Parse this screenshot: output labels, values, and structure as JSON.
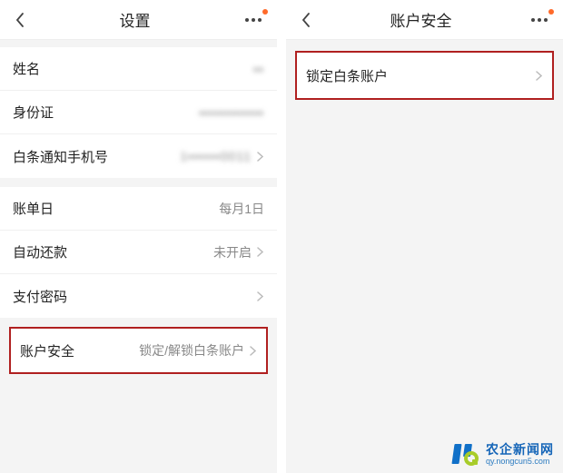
{
  "left": {
    "header": {
      "title": "设置"
    },
    "group1": {
      "name": {
        "label": "姓名",
        "value": "▪▪"
      },
      "idcard": {
        "label": "身份证",
        "value": "▪▪▪▪▪▪▪▪▪▪▪▪"
      },
      "phone": {
        "label": "白条通知手机号",
        "value": "1▪▪▪▪▪▪0011"
      }
    },
    "group2": {
      "billday": {
        "label": "账单日",
        "value": "每月1日"
      },
      "autorepay": {
        "label": "自动还款",
        "value": "未开启"
      },
      "paypwd": {
        "label": "支付密码",
        "value": ""
      }
    },
    "security": {
      "label": "账户安全",
      "value": "锁定/解锁白条账户"
    }
  },
  "right": {
    "header": {
      "title": "账户安全"
    },
    "item": {
      "label": "锁定白条账户"
    }
  },
  "brand": {
    "cn": "农企新闻网",
    "url": "qy.nongcun5.com"
  }
}
